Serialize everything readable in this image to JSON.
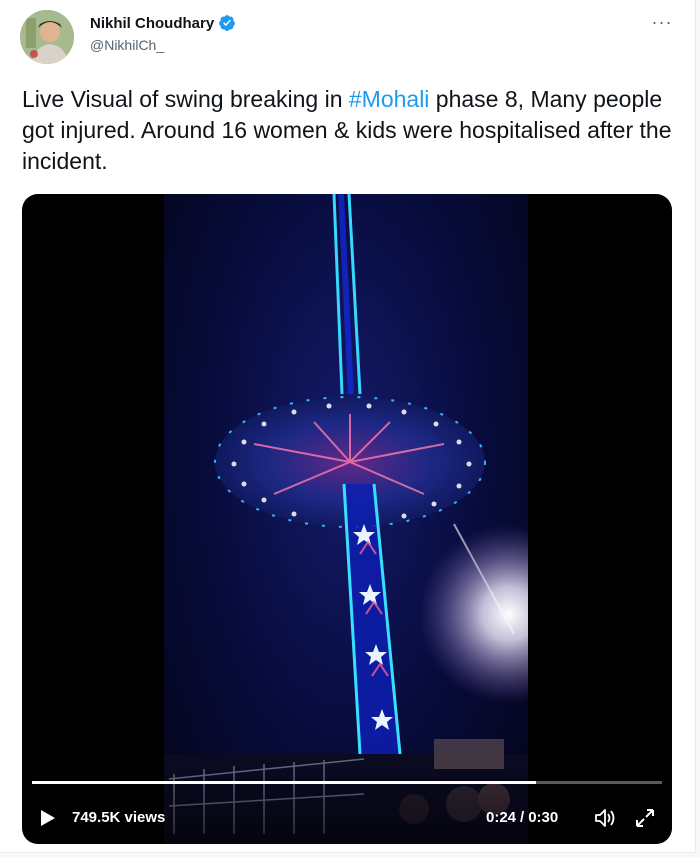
{
  "tweet": {
    "author_name": "Nikhil Choudhary",
    "author_handle": "@NikhilCh_",
    "verified": true,
    "text_before": "Live Visual of swing breaking in ",
    "hashtag": "#Mohali",
    "text_after": " phase 8, Many people got injured. Around 16 women & kids were hospitalised after the incident.",
    "more_label": "···"
  },
  "video": {
    "views": "749.5K views",
    "current_time": "0:24",
    "time_separator": "/",
    "duration": "0:30",
    "progress_fraction": 0.8
  },
  "colors": {
    "accent": "#1d9bf0",
    "text": "#0f1419",
    "secondary": "#536471"
  },
  "icons": {
    "verified": "verified-badge-icon",
    "more": "more-options-icon",
    "play": "play-icon",
    "volume": "volume-icon",
    "fullscreen": "fullscreen-icon"
  }
}
